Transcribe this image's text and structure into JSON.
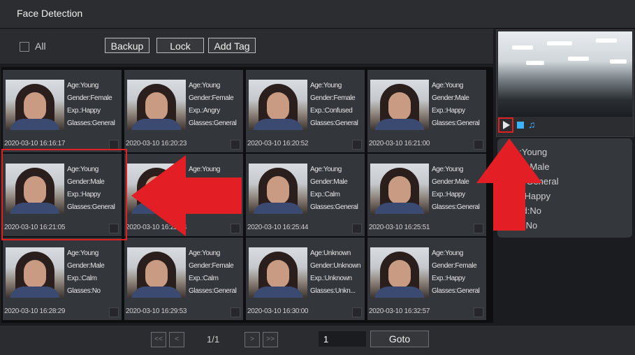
{
  "window": {
    "title": "Face Detection"
  },
  "toolbar": {
    "all_label": "All",
    "backup_label": "Backup",
    "lock_label": "Lock",
    "add_tag_label": "Add Tag"
  },
  "records": [
    {
      "age": "Age:Young",
      "gender": "Gender:Female",
      "exp": "Exp.:Happy",
      "glasses": "Glasses:General",
      "time": "2020-03-10 16:16:17"
    },
    {
      "age": "Age:Young",
      "gender": "Gender:Female",
      "exp": "Exp.:Angry",
      "glasses": "Glasses:General",
      "time": "2020-03-10 16:20:23"
    },
    {
      "age": "Age:Young",
      "gender": "Gender:Female",
      "exp": "Exp.:Confused",
      "glasses": "Glasses:General",
      "time": "2020-03-10 16:20:52"
    },
    {
      "age": "Age:Young",
      "gender": "Gender:Male",
      "exp": "Exp.:Happy",
      "glasses": "Glasses:General",
      "time": "2020-03-10 16:21:00"
    },
    {
      "age": "Age:Young",
      "gender": "Gender:Male",
      "exp": "Exp.:Happy",
      "glasses": "Glasses:General",
      "time": "2020-03-10 16:21:05"
    },
    {
      "age": "Age:Young",
      "gender": "",
      "exp": "",
      "glasses": "",
      "time": "2020-03-10 16:22:34"
    },
    {
      "age": "Age:Young",
      "gender": "Gender:Male",
      "exp": "Exp.:Calm",
      "glasses": "Glasses:General",
      "time": "2020-03-10 16:25:44"
    },
    {
      "age": "Age:Young",
      "gender": "Gender:Male",
      "exp": "Exp.:Happy",
      "glasses": "Glasses:General",
      "time": "2020-03-10 16:25:51"
    },
    {
      "age": "Age:Young",
      "gender": "Gender:Male",
      "exp": "Exp.:Calm",
      "glasses": "Glasses:No",
      "time": "2020-03-10 16:28:29"
    },
    {
      "age": "Age:Young",
      "gender": "Gender:Female",
      "exp": "Exp.:Calm",
      "glasses": "Glasses:General",
      "time": "2020-03-10 16:29:53"
    },
    {
      "age": "Age:Unknown",
      "gender": "Gender:Unknown",
      "exp": "Exp.:Unknown",
      "glasses": "Glasses:Unkn...",
      "time": "2020-03-10 16:30:00"
    },
    {
      "age": "Age:Young",
      "gender": "Gender:Female",
      "exp": "Exp.:Happy",
      "glasses": "Glasses:General",
      "time": "2020-03-10 16:32:57"
    }
  ],
  "details": {
    "lines": [
      "e:Young",
      "der:Male",
      "es:General",
      "p.:Happy",
      "ard:No",
      "sk:No"
    ]
  },
  "pagination": {
    "page_label": "1/1",
    "goto_value": "1",
    "goto_label": "Goto"
  },
  "colors": {
    "highlight": "#e02020",
    "accent": "#3db3ff"
  }
}
